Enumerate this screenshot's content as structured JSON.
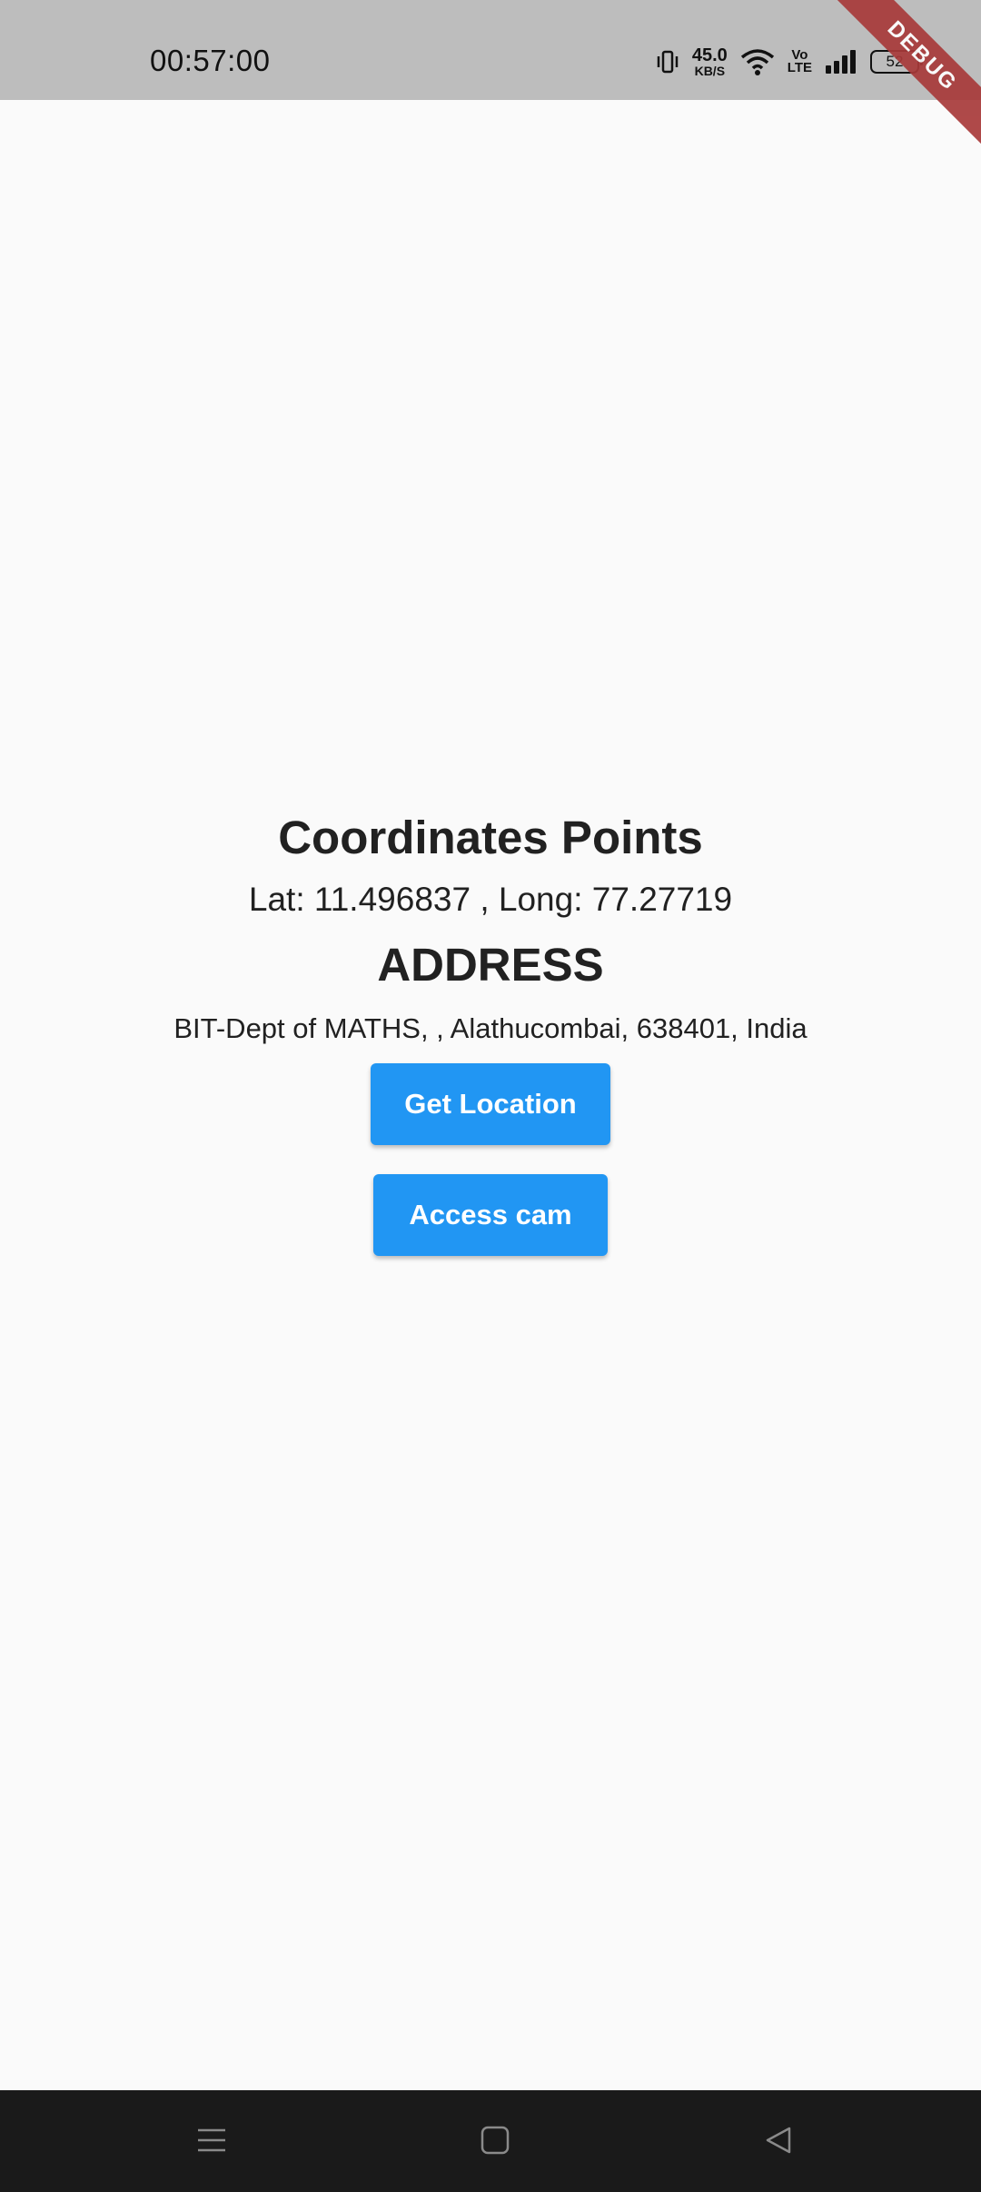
{
  "status_bar": {
    "time": "00:57:00",
    "network_speed_value": "45.0",
    "network_speed_unit": "KB/S",
    "volte_top": "Vo",
    "volte_bottom": "LTE",
    "battery_level": "52",
    "icons": [
      "vibrate-icon",
      "wifi-icon",
      "signal-icon",
      "battery-icon"
    ]
  },
  "debug_banner": "DEBUG",
  "main": {
    "coordinates_title": "Coordinates Points",
    "coordinates_value": "Lat: 11.496837 , Long: 77.27719",
    "address_title": "ADDRESS",
    "address_value": "BIT-Dept of MATHS, , Alathucombai, 638401, India",
    "get_location_label": "Get Location",
    "access_cam_label": "Access cam"
  },
  "nav_bar": {
    "icons": [
      "menu-icon",
      "home-icon",
      "back-icon"
    ]
  },
  "colors": {
    "primary_button": "#2196f3",
    "status_bar": "#bdbdbd",
    "background": "#fafafa",
    "nav_bar": "#1a1a1a",
    "debug_ribbon": "#a83a3a"
  }
}
